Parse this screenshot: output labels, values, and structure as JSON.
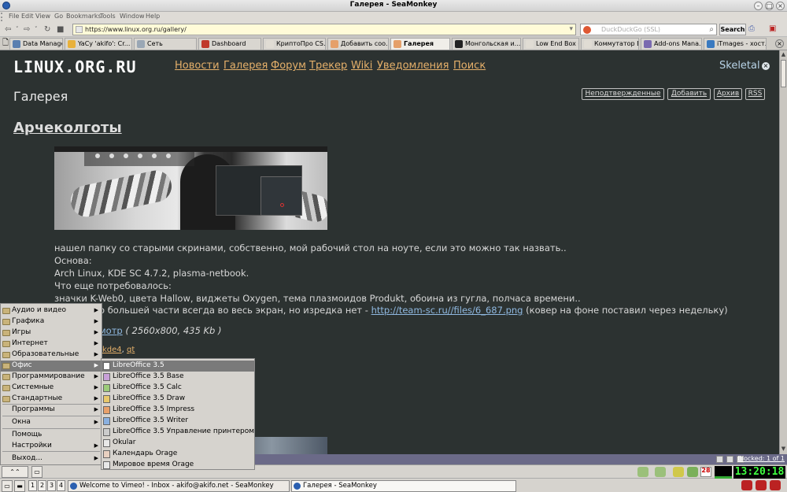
{
  "window": {
    "title": "Галерея - SeaMonkey"
  },
  "menubar": [
    "File",
    "Edit",
    "View",
    "Go",
    "Bookmarks",
    "Tools",
    "Window",
    "Help"
  ],
  "navbar": {
    "url": "https://www.linux.org.ru/gallery/",
    "search_placeholder": "DuckDuckGo (SSL)",
    "search_button": "Search"
  },
  "tabs": [
    {
      "label": "Data Manager",
      "color": "#5a7fb0"
    },
    {
      "label": "YaCy 'akifo': Cr...",
      "color": "#e8b13c"
    },
    {
      "label": "Сеть",
      "color": "#9aa7b5"
    },
    {
      "label": "Dashboard",
      "color": "#c0392b"
    },
    {
      "label": "КриптоПро CS...",
      "color": "#e0dcd4"
    },
    {
      "label": "Добавить соо...",
      "color": "#e5a06a"
    },
    {
      "label": "Галерея",
      "color": "#e5a06a"
    },
    {
      "label": "Монгольская и...",
      "color": "#222222"
    },
    {
      "label": "Low End Box - ...",
      "color": "#e0dcd4"
    },
    {
      "label": "Коммутатор Б...",
      "color": "#e0dcd4"
    },
    {
      "label": "Add-ons Mana...",
      "color": "#7a6ab0"
    },
    {
      "label": "iTmages - хост...",
      "color": "#3a7ac0"
    }
  ],
  "site": {
    "logo": "LINUX.ORG.RU",
    "nav": [
      "Новости",
      "Галерея",
      "Форум",
      "Трекер",
      "Wiki",
      "Уведомления",
      "Поиск"
    ],
    "user": "Skeletal",
    "page_title": "Галерея",
    "gallery_buttons": [
      "Неподтвержденные",
      "Добавить",
      "Архив",
      "RSS"
    ]
  },
  "post": {
    "title": "Арчеколготы",
    "lines": [
      "нашел папку со старыми скринами, собственно, мой рабочий стол на ноуте, если это можно так назвать..",
      "Основа:",
      "Arch Linux, KDE SC 4.7.2, plasma-netbook.",
      "Что еще потребовалось:",
      "значки K-Web0, цвета Hallow, виджеты Oxygen, тема плазмоидов Produkt, обоина из гугла, полчаса времени.."
    ],
    "line6_prefix": "о большей части всегда во весь экран, но изредка нет - ",
    "line6_link": "http://team-sc.ru//files/6_687.png",
    "line6_suffix": " (ковер на фоне поставил через недельку)",
    "view_link": "мотр",
    "view_meta": " ( 2560x800, 435 Kb )",
    "tags": [
      "kde4",
      "qt"
    ]
  },
  "statusbar": {
    "blocked": "Blocked: 1 of 1"
  },
  "start_menu": [
    "Аудио и видео",
    "Графика",
    "Игры",
    "Интернет",
    "Образовательные",
    "Офис",
    "Программирование",
    "Системные",
    "Стандартные",
    "Программы",
    "Окна",
    "Помощь",
    "Настройки",
    "Выход..."
  ],
  "office_submenu": [
    "LibreOffice 3.5",
    "LibreOffice 3.5 Base",
    "LibreOffice 3.5 Calc",
    "LibreOffice 3.5 Draw",
    "LibreOffice 3.5 Impress",
    "LibreOffice 3.5 Writer",
    "LibreOffice 3.5 Управление принтером",
    "Okular",
    "Календарь Orage",
    "Мировое время Orage"
  ],
  "taskbar": {
    "desktops": [
      "1",
      "2",
      "3",
      "4"
    ],
    "tasks": [
      "Welcome to Vimeo! - Inbox - akifo@akifo.net - SeaMonkey",
      "Галерея - SeaMonkey"
    ],
    "calendar_day": "28",
    "clock": "13:20:18"
  }
}
